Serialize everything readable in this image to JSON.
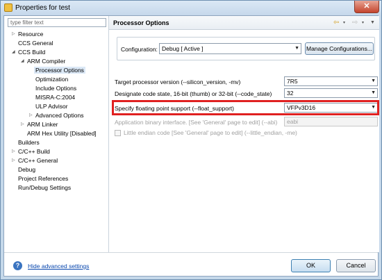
{
  "window": {
    "title": "Properties for test",
    "close_glyph": "✕"
  },
  "filter": {
    "placeholder": "type filter text"
  },
  "tree": [
    {
      "label": "Resource",
      "arrow": "▷"
    },
    {
      "label": "CCS General",
      "arrow": ""
    },
    {
      "label": "CCS Build",
      "arrow": "◢"
    },
    {
      "label": "ARM Compiler",
      "arrow": "◢"
    },
    {
      "label": "Processor Options",
      "arrow": ""
    },
    {
      "label": "Optimization",
      "arrow": ""
    },
    {
      "label": "Include Options",
      "arrow": ""
    },
    {
      "label": "MISRA-C:2004",
      "arrow": ""
    },
    {
      "label": "ULP Advisor",
      "arrow": ""
    },
    {
      "label": "Advanced Options",
      "arrow": "▷"
    },
    {
      "label": "ARM Linker",
      "arrow": "▷"
    },
    {
      "label": "ARM Hex Utility  [Disabled]",
      "arrow": ""
    },
    {
      "label": "Builders",
      "arrow": ""
    },
    {
      "label": "C/C++ Build",
      "arrow": "▷"
    },
    {
      "label": "C/C++ General",
      "arrow": "▷"
    },
    {
      "label": "Debug",
      "arrow": ""
    },
    {
      "label": "Project References",
      "arrow": ""
    },
    {
      "label": "Run/Debug Settings",
      "arrow": ""
    }
  ],
  "page": {
    "title": "Processor Options",
    "nav_back": "⇦",
    "nav_forward": "⇨",
    "nav_dropdown": "▾",
    "nav_menu": "▼"
  },
  "configuration": {
    "label": "Configuration:",
    "value": "Debug  [ Active ]",
    "manage_button": "Manage Configurations..."
  },
  "options": [
    {
      "label": "Target processor version (--silicon_version, -mv)",
      "value": "7R5"
    },
    {
      "label": "Designate code state, 16-bit (thumb) or 32-bit (--code_state)",
      "value": "32"
    },
    {
      "label": "Specify floating point support (--float_support)",
      "value": "VFPv3D16"
    },
    {
      "label": "Application binary interface. [See 'General' page to edit] (--abi)",
      "value": "eabi"
    }
  ],
  "checkbox": {
    "label": "Little endian code [See 'General' page to edit] (--little_endian, -me)"
  },
  "footer": {
    "help_glyph": "?",
    "help_link": "Hide advanced settings",
    "ok_label": "OK",
    "cancel_label": "Cancel"
  },
  "dropdown_glyph": "▼",
  "colors": {
    "highlight_border": "#e02020",
    "link": "#0645ad"
  }
}
